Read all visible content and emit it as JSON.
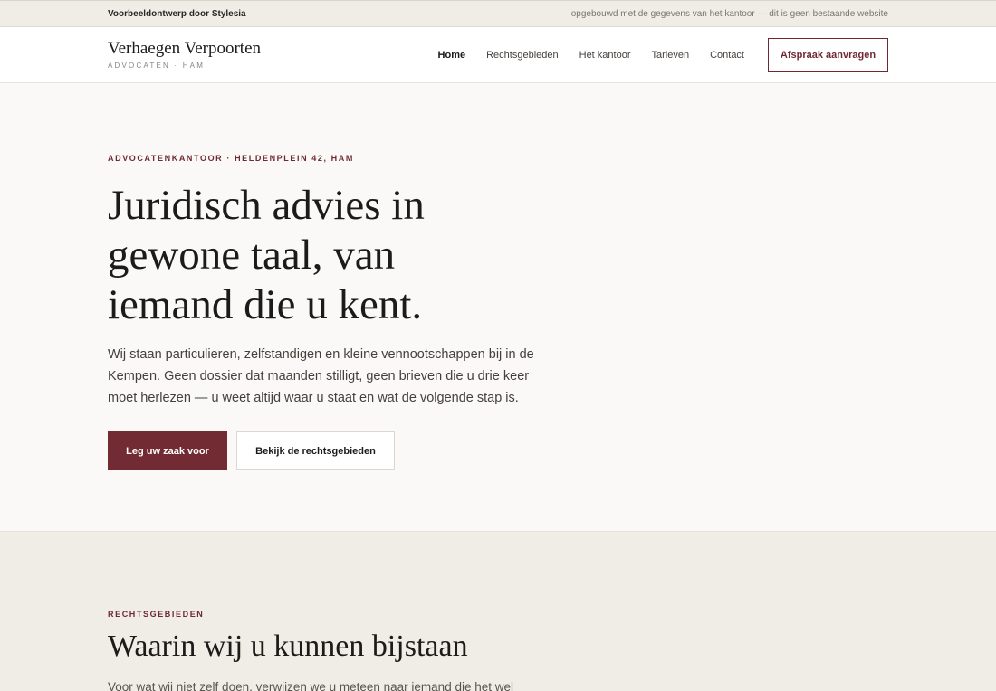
{
  "topbar": {
    "left": "Voorbeeldontwerp door Stylesia",
    "right": "opgebouwd met de gegevens van het kantoor — dit is geen bestaande website"
  },
  "header": {
    "brand_name": "Verhaegen Verpoorten",
    "brand_sub": "ADVOCATEN · HAM",
    "nav": {
      "home": "Home",
      "rechtsgebieden": "Rechtsgebieden",
      "kantoor": "Het kantoor",
      "tarieven": "Tarieven",
      "contact": "Contact"
    },
    "cta": "Afspraak aanvragen"
  },
  "hero": {
    "eyebrow": "ADVOCATENKANTOOR · HELDENPLEIN 42, HAM",
    "title": "Juridisch advies in gewone taal, van iemand die u kent.",
    "text": "Wij staan particulieren, zelfstandigen en kleine vennootschappen bij in de Kempen. Geen dossier dat maanden stilligt, geen brieven die u drie keer moet herlezen — u weet altijd waar u staat en wat de volgende stap is.",
    "primary_button": "Leg uw zaak voor",
    "secondary_button": "Bekijk de rechtsgebieden"
  },
  "areas": {
    "eyebrow": "RECHTSGEBIEDEN",
    "title": "Waarin wij u kunnen bijstaan",
    "text": "Voor wat wij niet zelf doen, verwijzen we u meteen naar iemand die het wel"
  },
  "colors": {
    "accent": "#722a33",
    "topbar_bg": "#f0ede7",
    "page_bg": "#faf9f7"
  }
}
